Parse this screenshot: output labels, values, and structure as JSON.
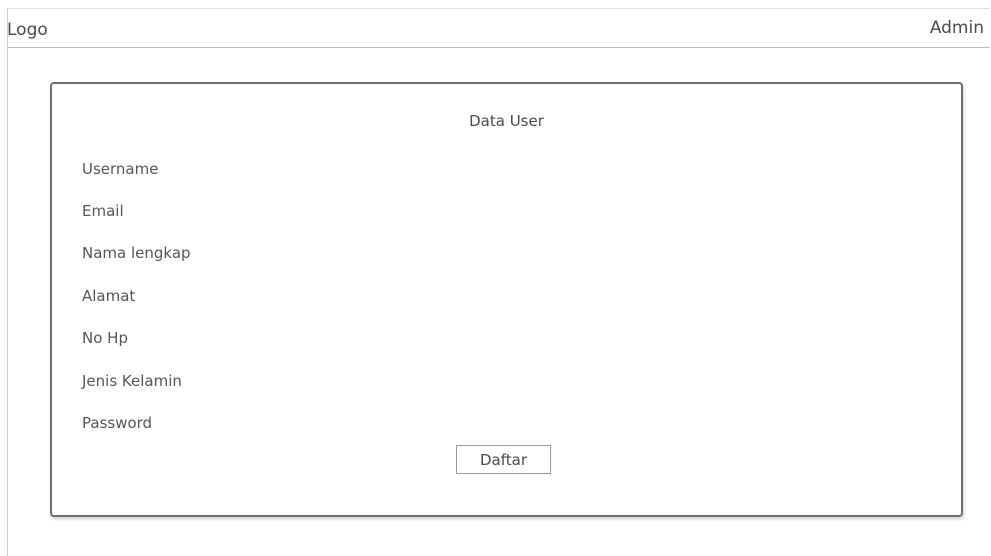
{
  "header": {
    "logo_text": "Logo",
    "user_label": "Admin"
  },
  "card": {
    "title": "Data User",
    "fields": [
      {
        "label": "Username"
      },
      {
        "label": "Email"
      },
      {
        "label": "Nama lengkap"
      },
      {
        "label": "Alamat"
      },
      {
        "label": "No Hp"
      },
      {
        "label": "Jenis Kelamin"
      },
      {
        "label": "Password"
      }
    ],
    "submit_label": "Daftar"
  }
}
